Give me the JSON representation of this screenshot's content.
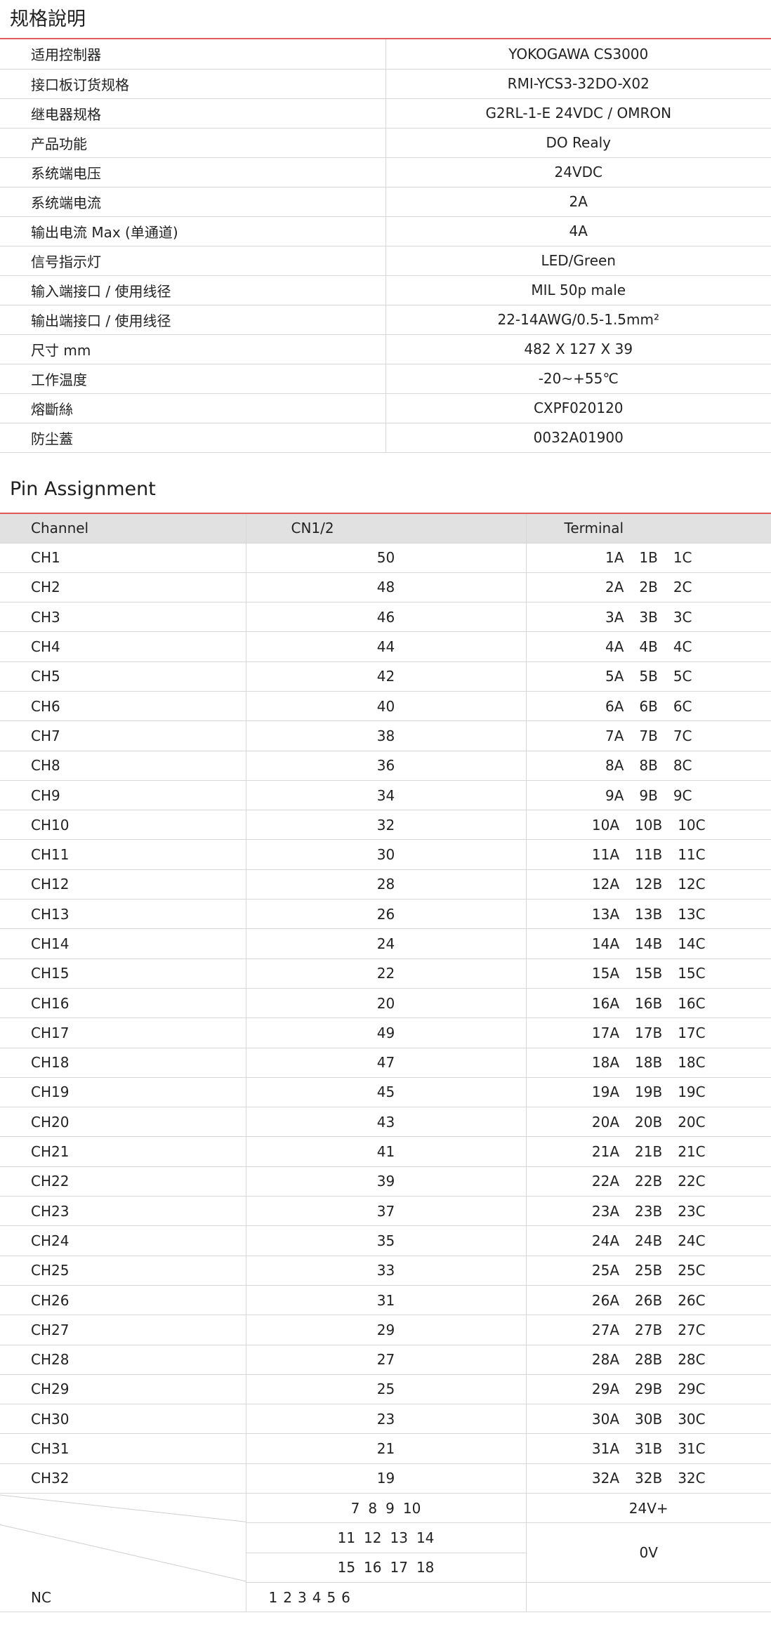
{
  "spec": {
    "title": "规格說明",
    "rows": [
      {
        "label": "适用控制器",
        "value": "YOKOGAWA  CS3000"
      },
      {
        "label": "接口板订货规格",
        "value": "RMI-YCS3-32DO-X02"
      },
      {
        "label": "继电器规格",
        "value": "G2RL-1-E  24VDC / OMRON"
      },
      {
        "label": "产品功能",
        "value": "DO Realy"
      },
      {
        "label": "系统端电压",
        "value": "24VDC"
      },
      {
        "label": "系统端电流",
        "value": "2A"
      },
      {
        "label": "输出电流 Max (单通道)",
        "value": "4A"
      },
      {
        "label": "信号指示灯",
        "value": "LED/Green"
      },
      {
        "label": "输入端接口 / 使用线径",
        "value": "MIL  50p  male"
      },
      {
        "label": "输出端接口 / 使用线径",
        "value": "22-14AWG/0.5-1.5mm²"
      },
      {
        "label": "尺寸 mm",
        "value": "482 X 127 X 39"
      },
      {
        "label": "工作温度",
        "value": "-20~+55℃"
      },
      {
        "label": "熔斷絲",
        "value": "CXPF020120"
      },
      {
        "label": "防尘蓋",
        "value": "0032A01900"
      }
    ]
  },
  "pins": {
    "title": "Pin Assignment",
    "headers": {
      "channel": "Channel",
      "cn": "CN1/2",
      "terminal": "Terminal"
    },
    "rows": [
      {
        "ch": "CH1",
        "cn": "50",
        "t": [
          "1A",
          "1B",
          "1C"
        ]
      },
      {
        "ch": "CH2",
        "cn": "48",
        "t": [
          "2A",
          "2B",
          "2C"
        ]
      },
      {
        "ch": "CH3",
        "cn": "46",
        "t": [
          "3A",
          "3B",
          "3C"
        ]
      },
      {
        "ch": "CH4",
        "cn": "44",
        "t": [
          "4A",
          "4B",
          "4C"
        ]
      },
      {
        "ch": "CH5",
        "cn": "42",
        "t": [
          "5A",
          "5B",
          "5C"
        ]
      },
      {
        "ch": "CH6",
        "cn": "40",
        "t": [
          "6A",
          "6B",
          "6C"
        ]
      },
      {
        "ch": "CH7",
        "cn": "38",
        "t": [
          "7A",
          "7B",
          "7C"
        ]
      },
      {
        "ch": "CH8",
        "cn": "36",
        "t": [
          "8A",
          "8B",
          "8C"
        ]
      },
      {
        "ch": "CH9",
        "cn": "34",
        "t": [
          "9A",
          "9B",
          "9C"
        ]
      },
      {
        "ch": "CH10",
        "cn": "32",
        "t": [
          "10A",
          "10B",
          "10C"
        ]
      },
      {
        "ch": "CH11",
        "cn": "30",
        "t": [
          "11A",
          "11B",
          "11C"
        ]
      },
      {
        "ch": "CH12",
        "cn": "28",
        "t": [
          "12A",
          "12B",
          "12C"
        ]
      },
      {
        "ch": "CH13",
        "cn": "26",
        "t": [
          "13A",
          "13B",
          "13C"
        ]
      },
      {
        "ch": "CH14",
        "cn": "24",
        "t": [
          "14A",
          "14B",
          "14C"
        ]
      },
      {
        "ch": "CH15",
        "cn": "22",
        "t": [
          "15A",
          "15B",
          "15C"
        ]
      },
      {
        "ch": "CH16",
        "cn": "20",
        "t": [
          "16A",
          "16B",
          "16C"
        ]
      },
      {
        "ch": "CH17",
        "cn": "49",
        "t": [
          "17A",
          "17B",
          "17C"
        ]
      },
      {
        "ch": "CH18",
        "cn": "47",
        "t": [
          "18A",
          "18B",
          "18C"
        ]
      },
      {
        "ch": "CH19",
        "cn": "45",
        "t": [
          "19A",
          "19B",
          "19C"
        ]
      },
      {
        "ch": "CH20",
        "cn": "43",
        "t": [
          "20A",
          "20B",
          "20C"
        ]
      },
      {
        "ch": "CH21",
        "cn": "41",
        "t": [
          "21A",
          "21B",
          "21C"
        ]
      },
      {
        "ch": "CH22",
        "cn": "39",
        "t": [
          "22A",
          "22B",
          "22C"
        ]
      },
      {
        "ch": "CH23",
        "cn": "37",
        "t": [
          "23A",
          "23B",
          "23C"
        ]
      },
      {
        "ch": "CH24",
        "cn": "35",
        "t": [
          "24A",
          "24B",
          "24C"
        ]
      },
      {
        "ch": "CH25",
        "cn": "33",
        "t": [
          "25A",
          "25B",
          "25C"
        ]
      },
      {
        "ch": "CH26",
        "cn": "31",
        "t": [
          "26A",
          "26B",
          "26C"
        ]
      },
      {
        "ch": "CH27",
        "cn": "29",
        "t": [
          "27A",
          "27B",
          "27C"
        ]
      },
      {
        "ch": "CH28",
        "cn": "27",
        "t": [
          "28A",
          "28B",
          "28C"
        ]
      },
      {
        "ch": "CH29",
        "cn": "25",
        "t": [
          "29A",
          "29B",
          "29C"
        ]
      },
      {
        "ch": "CH30",
        "cn": "23",
        "t": [
          "30A",
          "30B",
          "30C"
        ]
      },
      {
        "ch": "CH31",
        "cn": "21",
        "t": [
          "31A",
          "31B",
          "31C"
        ]
      },
      {
        "ch": "CH32",
        "cn": "19",
        "t": [
          "32A",
          "32B",
          "32C"
        ]
      }
    ],
    "power": {
      "v24_pins": [
        "7",
        "8",
        "9",
        "10"
      ],
      "v24_label": "24V+",
      "v0_pins_a": [
        "11",
        "12",
        "13",
        "14"
      ],
      "v0_pins_b": [
        "15",
        "16",
        "17",
        "18"
      ],
      "v0_label": "0V",
      "nc_label": "NC",
      "nc_pins": [
        "1",
        "2",
        "3",
        "4",
        "5",
        "6"
      ]
    }
  }
}
